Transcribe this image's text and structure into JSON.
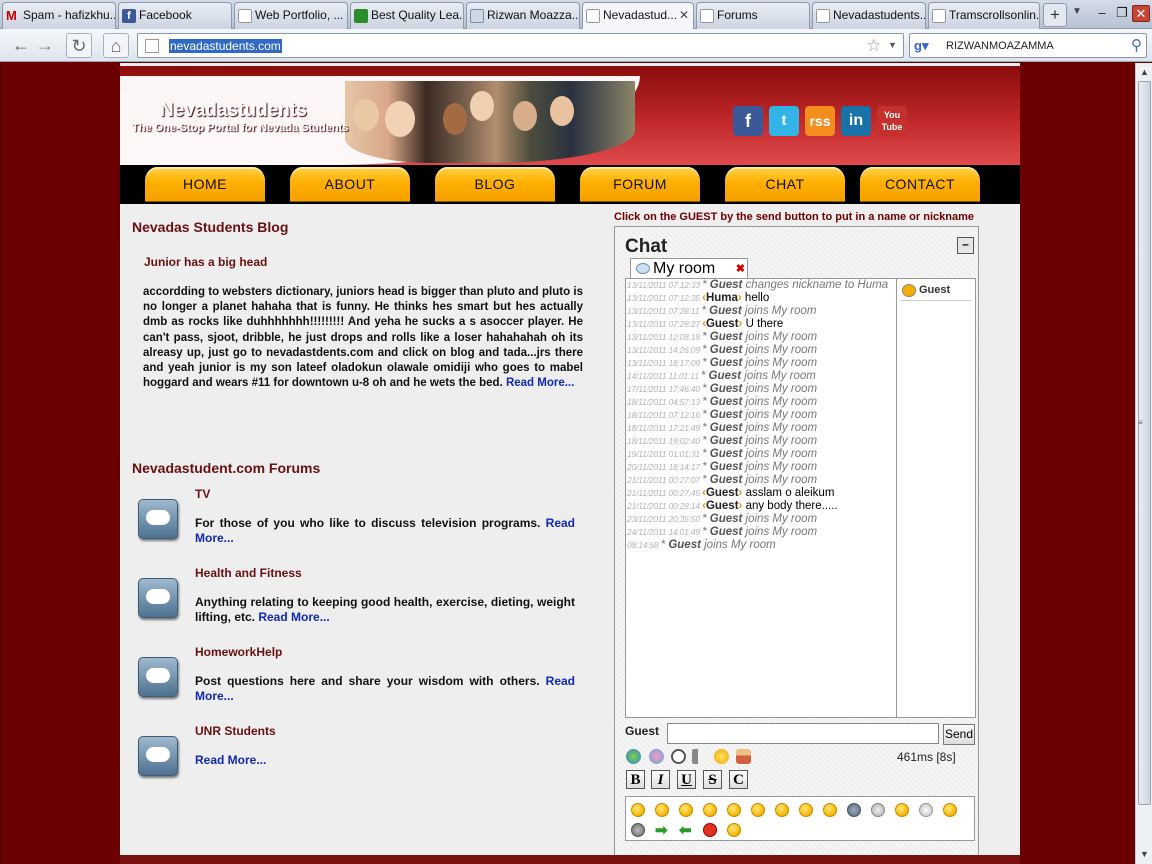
{
  "browser": {
    "tabs": [
      {
        "label": "Spam - hafizkhu...",
        "icon": "gmail-icon"
      },
      {
        "label": "Facebook",
        "icon": "facebook-icon"
      },
      {
        "label": "Web Portfolio, ...",
        "icon": "page-icon"
      },
      {
        "label": "Best Quality Lea...",
        "icon": "green-icon"
      },
      {
        "label": "Rizwan Moazza...",
        "icon": "picture-icon"
      },
      {
        "label": "Nevadastud...",
        "icon": "page-icon",
        "active": true
      },
      {
        "label": "Forums",
        "icon": "page-icon"
      },
      {
        "label": "Nevadastudents...",
        "icon": "page-icon"
      },
      {
        "label": "Tramscrollsonlin...",
        "icon": "page-icon"
      }
    ],
    "new_tab": "+",
    "url": "nevadastudents.com",
    "search_engine_icon": "google-icon",
    "search_text": "RIZWANMOAZAMMA"
  },
  "site": {
    "title": "Nevadastudents",
    "tagline": "The One-Stop Portal for Nevada Students",
    "social": {
      "facebook": "f",
      "twitter": "t",
      "rss": "rss",
      "linkedin": "in",
      "youtube": "You Tube"
    },
    "menu": [
      "HOME",
      "ABOUT",
      "BLOG",
      "FORUM",
      "CHAT",
      "CONTACT"
    ]
  },
  "blog": {
    "heading": "Nevadas Students Blog",
    "post_title": "Junior has a big head",
    "post_body": "accordding to websters dictionary, juniors head is bigger than pluto and pluto is no longer a planet hahaha that is funny. He thinks hes smart but hes actually dmb as rocks like duhhhhhhh!!!!!!!!! And yeha he sucks a s asoccer player. He can't pass, sjoot, dribble, he just drops and rolls like a loser hahahahah oh its alreasy up, just go to nevadastdents.com and click on blog and tada...jrs there and yeah junior is my son lateef oladokun olawale omidiji who goes to mabel hoggard and wears #11 for downtown u-8 oh and he wets the bed.",
    "read_more": "Read More..."
  },
  "forums": {
    "heading": "Nevadastudent.com Forums",
    "items": [
      {
        "title": "TV",
        "desc": "For those of you who like to discuss television programs.",
        "read_more": "Read More..."
      },
      {
        "title": "Health and Fitness",
        "desc": "Anything relating to keeping good health, exercise, dieting, weight lifting, etc.",
        "read_more": "Read More..."
      },
      {
        "title": "HomeworkHelp",
        "desc": "Post questions here and share your wisdom with others.",
        "read_more": "Read More..."
      },
      {
        "title": "UNR Students",
        "desc": "",
        "read_more": "Read More..."
      }
    ]
  },
  "chat": {
    "hint": "Click on the GUEST by the send button to put in a name or nickname",
    "title": "Chat",
    "minimize": "–",
    "room": "My room",
    "messages": [
      {
        "time": "13/11/2011 07:12:33",
        "type": "sys",
        "nick": "Guest",
        "text": "changes nickname to Huma"
      },
      {
        "time": "13/11/2011 07:12:35",
        "type": "msg",
        "nick": "Huma",
        "text": "hello"
      },
      {
        "time": "13/11/2011 07:28:11",
        "type": "sys",
        "nick": "Guest",
        "text": "joins My room"
      },
      {
        "time": "13/11/2011 07:28:27",
        "type": "msg",
        "nick": "Guest",
        "text": "U there"
      },
      {
        "time": "13/11/2011 12:08:18",
        "type": "sys",
        "nick": "Guest",
        "text": "joins My room"
      },
      {
        "time": "13/11/2011 14:26:09",
        "type": "sys",
        "nick": "Guest",
        "text": "joins My room"
      },
      {
        "time": "13/11/2011 18:17:09",
        "type": "sys",
        "nick": "Guest",
        "text": "joins My room"
      },
      {
        "time": "14/11/2011 11:01:11",
        "type": "sys",
        "nick": "Guest",
        "text": "joins My room"
      },
      {
        "time": "17/11/2011 17:46:40",
        "type": "sys",
        "nick": "Guest",
        "text": "joins My room"
      },
      {
        "time": "18/11/2011 04:57:13",
        "type": "sys",
        "nick": "Guest",
        "text": "joins My room"
      },
      {
        "time": "18/11/2011 07:12:16",
        "type": "sys",
        "nick": "Guest",
        "text": "joins My room"
      },
      {
        "time": "18/11/2011 17:21:49",
        "type": "sys",
        "nick": "Guest",
        "text": "joins My room"
      },
      {
        "time": "18/11/2011 19:02:40",
        "type": "sys",
        "nick": "Guest",
        "text": "joins My room"
      },
      {
        "time": "19/11/2011 01:01:31",
        "type": "sys",
        "nick": "Guest",
        "text": "joins My room"
      },
      {
        "time": "20/11/2011 18:14:17",
        "type": "sys",
        "nick": "Guest",
        "text": "joins My room"
      },
      {
        "time": "21/11/2011 00:27:07",
        "type": "sys",
        "nick": "Guest",
        "text": "joins My room"
      },
      {
        "time": "21/11/2011 00:27:45",
        "type": "msg",
        "nick": "Guest",
        "text": "asslam o aleikum"
      },
      {
        "time": "21/11/2011 00:28:14",
        "type": "msg",
        "nick": "Guest",
        "text": "any body there....."
      },
      {
        "time": "23/11/2011 20:35:50",
        "type": "sys",
        "nick": "Guest",
        "text": "joins My room"
      },
      {
        "time": "24/11/2011 14:01:49",
        "type": "sys",
        "nick": "Guest",
        "text": "joins My room"
      },
      {
        "time": "08:14:58",
        "type": "sys",
        "nick": "Guest",
        "text": "joins My room"
      }
    ],
    "users": [
      "Guest"
    ],
    "nick_label": "Guest",
    "input_value": "",
    "send": "Send",
    "latency": "461ms [8s]",
    "format_buttons": [
      "B",
      "I",
      "U",
      "S",
      "C"
    ],
    "tools": [
      "color-icon",
      "palette-icon",
      "clock-icon",
      "sound-icon",
      "smiley-icon",
      "user-icon"
    ]
  }
}
